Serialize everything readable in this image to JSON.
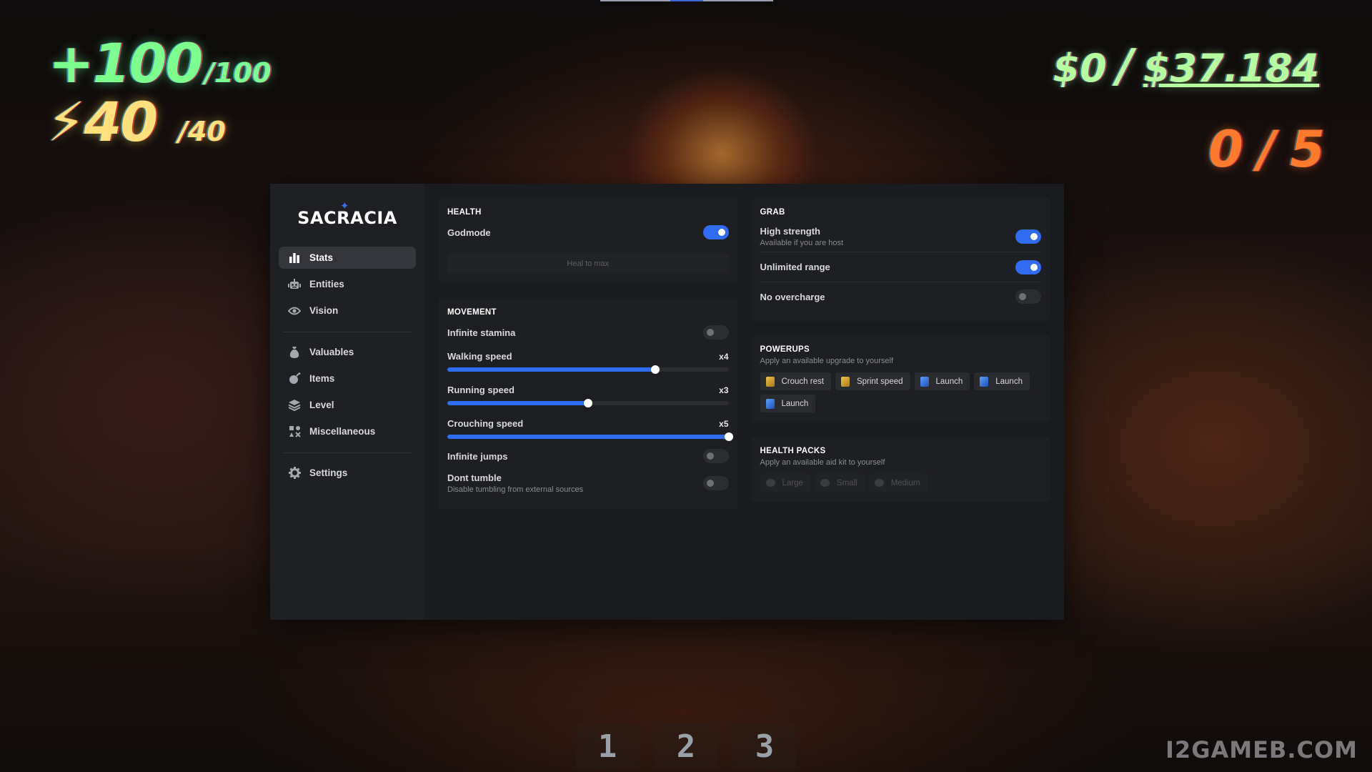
{
  "hud": {
    "health_current": "+100",
    "health_max": "/100",
    "energy_current": "⚡40",
    "energy_max": "/40",
    "money_current": "$0",
    "money_separator": "/",
    "money_total": "$37.184",
    "quota_current": "0",
    "quota_separator": "/",
    "quota_total": "5",
    "hotbar": [
      "1",
      "2",
      "3"
    ],
    "watermark": "I2GAMEB.COM"
  },
  "menu": {
    "logo": "SACRACIA",
    "sidebar": {
      "active": "Stats",
      "groups": [
        [
          {
            "label": "Stats",
            "icon": "bar-chart-icon"
          },
          {
            "label": "Entities",
            "icon": "robot-icon"
          },
          {
            "label": "Vision",
            "icon": "eye-icon"
          }
        ],
        [
          {
            "label": "Valuables",
            "icon": "money-bag-icon"
          },
          {
            "label": "Items",
            "icon": "bomb-icon"
          },
          {
            "label": "Level",
            "icon": "layers-icon"
          },
          {
            "label": "Miscellaneous",
            "icon": "misc-grid-icon"
          }
        ],
        [
          {
            "label": "Settings",
            "icon": "gear-icon"
          }
        ]
      ]
    },
    "health": {
      "title": "HEALTH",
      "godmode": {
        "label": "Godmode",
        "on": true
      },
      "heal_button": "Heal to max"
    },
    "movement": {
      "title": "MOVEMENT",
      "infinite_stamina": {
        "label": "Infinite stamina",
        "on": false
      },
      "walking_speed": {
        "label": "Walking speed",
        "value": "x4",
        "fraction": 0.74
      },
      "running_speed": {
        "label": "Running speed",
        "value": "x3",
        "fraction": 0.5
      },
      "crouching_speed": {
        "label": "Crouching speed",
        "value": "x5",
        "fraction": 1.0
      },
      "infinite_jumps": {
        "label": "Infinite jumps",
        "on": false
      },
      "dont_tumble": {
        "label": "Dont tumble",
        "description": "Disable tumbling from external sources",
        "on": false
      }
    },
    "grab": {
      "title": "GRAB",
      "high_strength": {
        "label": "High strength",
        "description": "Available if you are host",
        "on": true
      },
      "unlimited_range": {
        "label": "Unlimited range",
        "on": true
      },
      "no_overcharge": {
        "label": "No overcharge",
        "on": false
      }
    },
    "powerups": {
      "title": "POWERUPS",
      "subtitle": "Apply an available upgrade to yourself",
      "items": [
        {
          "label": "Crouch rest",
          "icon": "upgrade-gold-icon"
        },
        {
          "label": "Sprint speed",
          "icon": "upgrade-gold-icon"
        },
        {
          "label": "Launch",
          "icon": "upgrade-blue-icon"
        },
        {
          "label": "Launch",
          "icon": "upgrade-blue-icon"
        },
        {
          "label": "Launch",
          "icon": "upgrade-blue-icon"
        }
      ]
    },
    "health_packs": {
      "title": "HEALTH PACKS",
      "subtitle": "Apply an available aid kit to yourself",
      "items": [
        {
          "label": "Large",
          "icon": "health-pack-icon"
        },
        {
          "label": "Small",
          "icon": "health-pack-icon"
        },
        {
          "label": "Medium",
          "icon": "health-pack-icon"
        }
      ]
    }
  },
  "colors": {
    "accent": "#2f6cf2",
    "panel": "#1a1b1e",
    "sidebar": "#1f2023",
    "card": "#1e1f22"
  }
}
